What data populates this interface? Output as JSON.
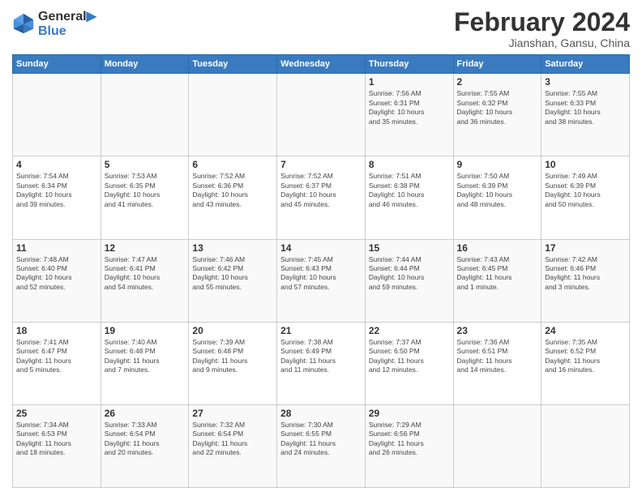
{
  "header": {
    "logo_line1": "General",
    "logo_line2": "Blue",
    "title": "February 2024",
    "subtitle": "Jianshan, Gansu, China"
  },
  "weekdays": [
    "Sunday",
    "Monday",
    "Tuesday",
    "Wednesday",
    "Thursday",
    "Friday",
    "Saturday"
  ],
  "weeks": [
    [
      {
        "day": "",
        "info": ""
      },
      {
        "day": "",
        "info": ""
      },
      {
        "day": "",
        "info": ""
      },
      {
        "day": "",
        "info": ""
      },
      {
        "day": "1",
        "info": "Sunrise: 7:56 AM\nSunset: 6:31 PM\nDaylight: 10 hours\nand 35 minutes."
      },
      {
        "day": "2",
        "info": "Sunrise: 7:55 AM\nSunset: 6:32 PM\nDaylight: 10 hours\nand 36 minutes."
      },
      {
        "day": "3",
        "info": "Sunrise: 7:55 AM\nSunset: 6:33 PM\nDaylight: 10 hours\nand 38 minutes."
      }
    ],
    [
      {
        "day": "4",
        "info": "Sunrise: 7:54 AM\nSunset: 6:34 PM\nDaylight: 10 hours\nand 39 minutes."
      },
      {
        "day": "5",
        "info": "Sunrise: 7:53 AM\nSunset: 6:35 PM\nDaylight: 10 hours\nand 41 minutes."
      },
      {
        "day": "6",
        "info": "Sunrise: 7:52 AM\nSunset: 6:36 PM\nDaylight: 10 hours\nand 43 minutes."
      },
      {
        "day": "7",
        "info": "Sunrise: 7:52 AM\nSunset: 6:37 PM\nDaylight: 10 hours\nand 45 minutes."
      },
      {
        "day": "8",
        "info": "Sunrise: 7:51 AM\nSunset: 6:38 PM\nDaylight: 10 hours\nand 46 minutes."
      },
      {
        "day": "9",
        "info": "Sunrise: 7:50 AM\nSunset: 6:39 PM\nDaylight: 10 hours\nand 48 minutes."
      },
      {
        "day": "10",
        "info": "Sunrise: 7:49 AM\nSunset: 6:39 PM\nDaylight: 10 hours\nand 50 minutes."
      }
    ],
    [
      {
        "day": "11",
        "info": "Sunrise: 7:48 AM\nSunset: 6:40 PM\nDaylight: 10 hours\nand 52 minutes."
      },
      {
        "day": "12",
        "info": "Sunrise: 7:47 AM\nSunset: 6:41 PM\nDaylight: 10 hours\nand 54 minutes."
      },
      {
        "day": "13",
        "info": "Sunrise: 7:46 AM\nSunset: 6:42 PM\nDaylight: 10 hours\nand 55 minutes."
      },
      {
        "day": "14",
        "info": "Sunrise: 7:45 AM\nSunset: 6:43 PM\nDaylight: 10 hours\nand 57 minutes."
      },
      {
        "day": "15",
        "info": "Sunrise: 7:44 AM\nSunset: 6:44 PM\nDaylight: 10 hours\nand 59 minutes."
      },
      {
        "day": "16",
        "info": "Sunrise: 7:43 AM\nSunset: 6:45 PM\nDaylight: 11 hours\nand 1 minute."
      },
      {
        "day": "17",
        "info": "Sunrise: 7:42 AM\nSunset: 6:46 PM\nDaylight: 11 hours\nand 3 minutes."
      }
    ],
    [
      {
        "day": "18",
        "info": "Sunrise: 7:41 AM\nSunset: 6:47 PM\nDaylight: 11 hours\nand 5 minutes."
      },
      {
        "day": "19",
        "info": "Sunrise: 7:40 AM\nSunset: 6:48 PM\nDaylight: 11 hours\nand 7 minutes."
      },
      {
        "day": "20",
        "info": "Sunrise: 7:39 AM\nSunset: 6:48 PM\nDaylight: 11 hours\nand 9 minutes."
      },
      {
        "day": "21",
        "info": "Sunrise: 7:38 AM\nSunset: 6:49 PM\nDaylight: 11 hours\nand 11 minutes."
      },
      {
        "day": "22",
        "info": "Sunrise: 7:37 AM\nSunset: 6:50 PM\nDaylight: 11 hours\nand 12 minutes."
      },
      {
        "day": "23",
        "info": "Sunrise: 7:36 AM\nSunset: 6:51 PM\nDaylight: 11 hours\nand 14 minutes."
      },
      {
        "day": "24",
        "info": "Sunrise: 7:35 AM\nSunset: 6:52 PM\nDaylight: 11 hours\nand 16 minutes."
      }
    ],
    [
      {
        "day": "25",
        "info": "Sunrise: 7:34 AM\nSunset: 6:53 PM\nDaylight: 11 hours\nand 18 minutes."
      },
      {
        "day": "26",
        "info": "Sunrise: 7:33 AM\nSunset: 6:54 PM\nDaylight: 11 hours\nand 20 minutes."
      },
      {
        "day": "27",
        "info": "Sunrise: 7:32 AM\nSunset: 6:54 PM\nDaylight: 11 hours\nand 22 minutes."
      },
      {
        "day": "28",
        "info": "Sunrise: 7:30 AM\nSunset: 6:55 PM\nDaylight: 11 hours\nand 24 minutes."
      },
      {
        "day": "29",
        "info": "Sunrise: 7:29 AM\nSunset: 6:56 PM\nDaylight: 11 hours\nand 26 minutes."
      },
      {
        "day": "",
        "info": ""
      },
      {
        "day": "",
        "info": ""
      }
    ]
  ]
}
